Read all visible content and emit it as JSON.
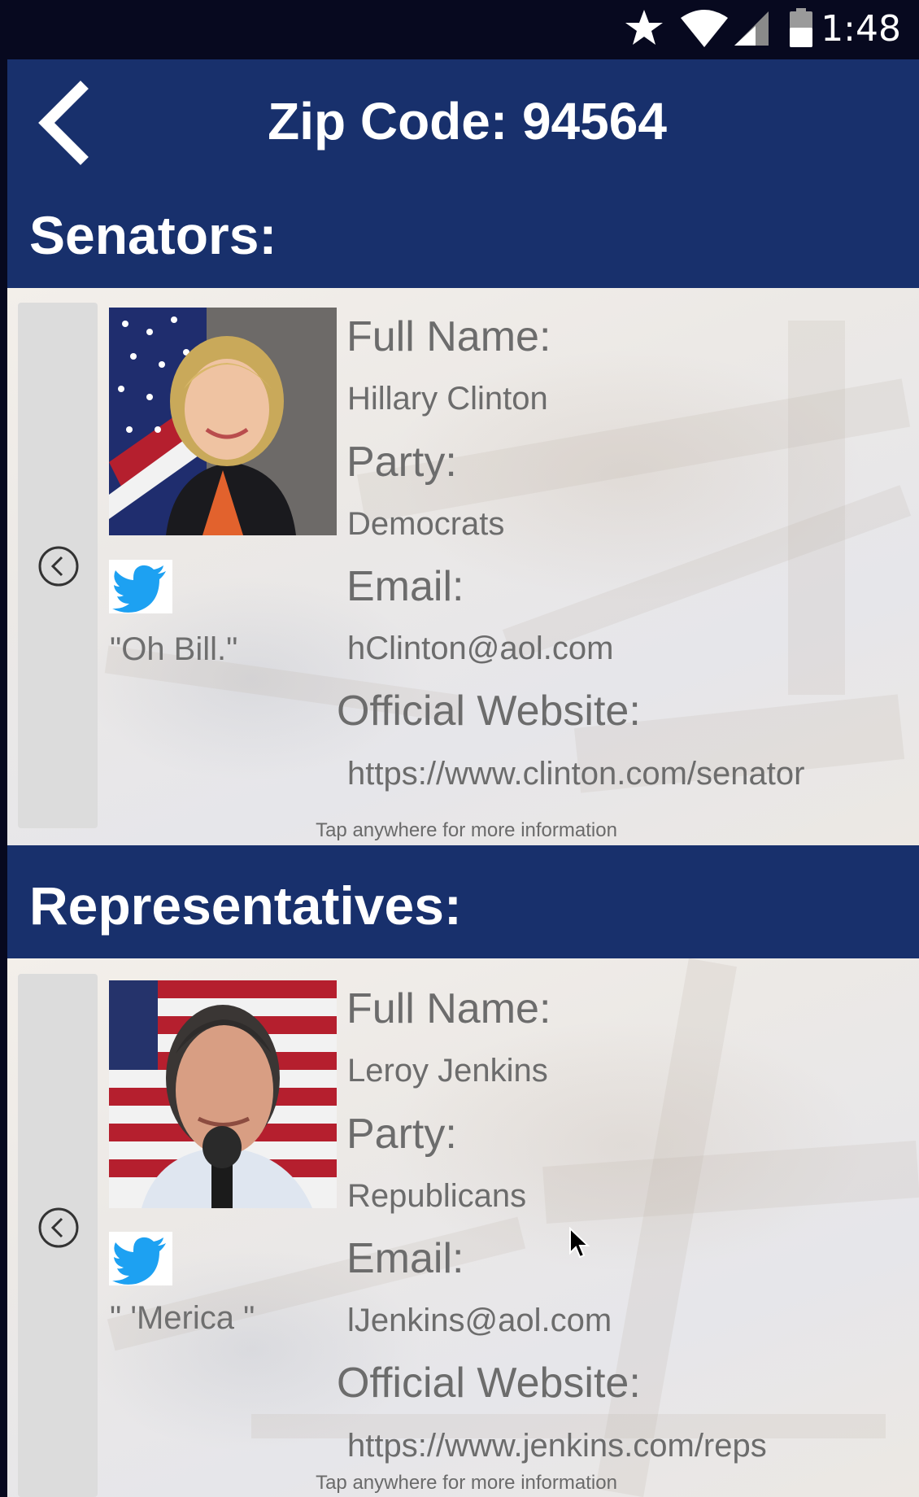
{
  "status_bar": {
    "time": "1:48",
    "icons": [
      "star-icon",
      "wifi-icon",
      "cell-signal-icon",
      "battery-icon"
    ]
  },
  "app_bar": {
    "back_icon": "chevron-left-icon",
    "title": "Zip Code: 94564"
  },
  "colors": {
    "header_blue": "#18306c",
    "status_bar": "#07091f",
    "text_gray": "#6c6c6c",
    "twitter_blue": "#1da1f2",
    "side_panel": "#dcdcdc"
  },
  "senators": {
    "heading": "Senators:",
    "card": {
      "prev_icon": "circle-chevron-left-icon",
      "photo": "senator-portrait",
      "twitter_icon": "twitter-bird-icon",
      "tweet": "\"Oh Bill.\"",
      "full_name_label": "Full Name:",
      "full_name": "Hillary Clinton",
      "party_label": "Party:",
      "party": "Democrats",
      "email_label": "Email:",
      "email": "hClinton@aol.com",
      "website_label": "Official Website:",
      "website": "https://www.clinton.com/senator",
      "hint": "Tap anywhere for more information"
    }
  },
  "representatives": {
    "heading": "Representatives:",
    "card": {
      "prev_icon": "circle-chevron-left-icon",
      "photo": "representative-portrait",
      "twitter_icon": "twitter-bird-icon",
      "tweet": "\" 'Merica \"",
      "full_name_label": "Full Name:",
      "full_name": "Leroy Jenkins",
      "party_label": "Party:",
      "party": "Republicans",
      "email_label": "Email:",
      "email": "lJenkins@aol.com",
      "website_label": "Official Website:",
      "website": "https://www.jenkins.com/reps",
      "hint": "Tap anywhere for more information"
    }
  }
}
